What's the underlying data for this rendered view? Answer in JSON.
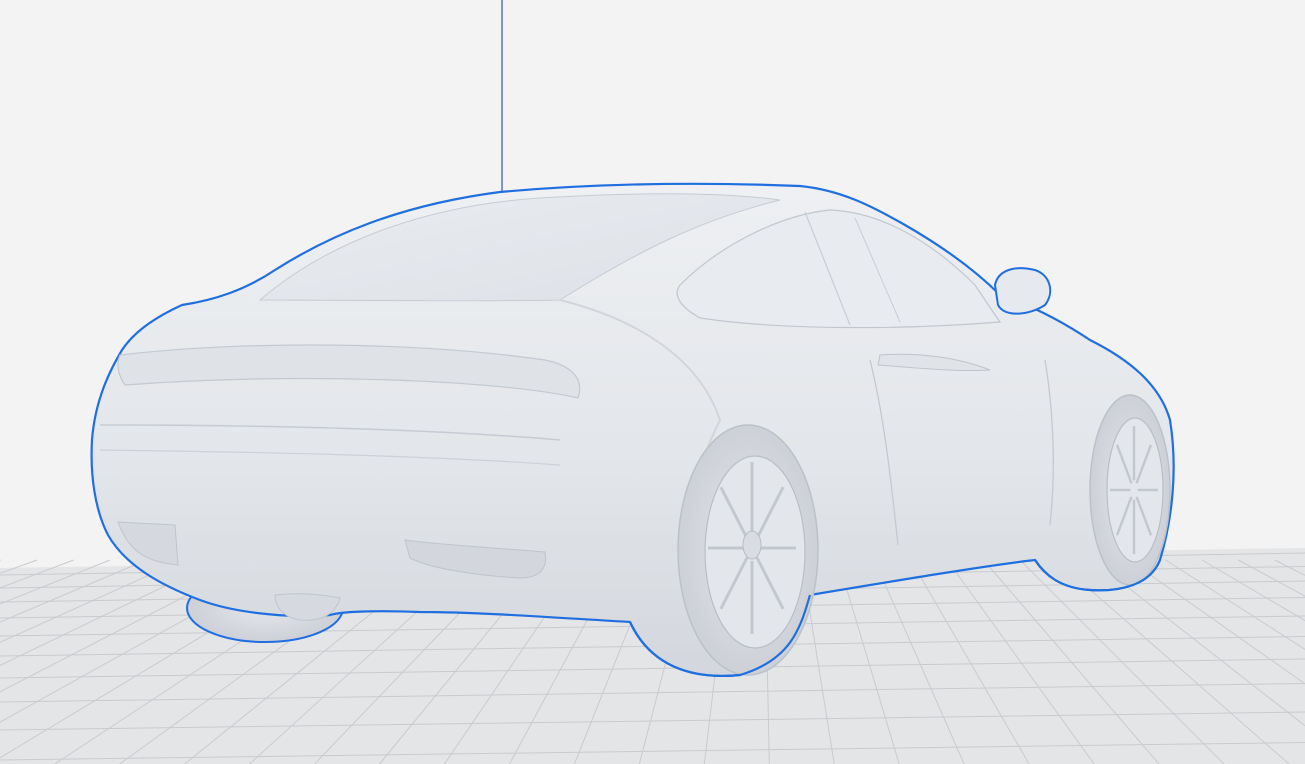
{
  "app": {
    "view": "3d-viewport"
  },
  "scene": {
    "background_color": "#f3f3f3",
    "build_plate_color": "#e4e5e7",
    "grid_line_color": "#c9cbcf",
    "axis_line_color": "#2f55c8",
    "model": {
      "name_icon": "car-model",
      "selected": true,
      "body_color": "#e6e8ec",
      "shade_color": "#cfd3da",
      "outline_color": "#1f6fe0"
    }
  }
}
